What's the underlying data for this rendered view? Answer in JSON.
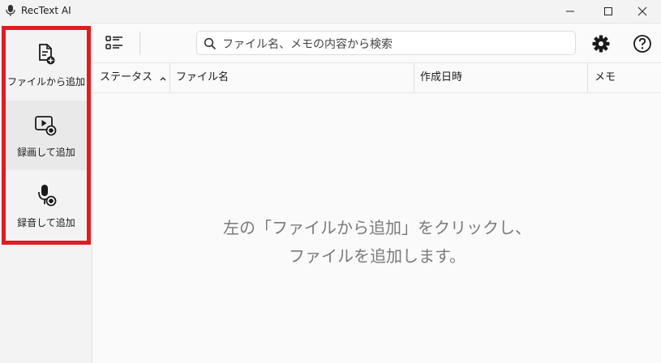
{
  "window": {
    "title": "RecText AI"
  },
  "sidebar": {
    "items": [
      {
        "label": "ファイルから追加",
        "icon": "file-add-icon"
      },
      {
        "label": "録画して追加",
        "icon": "video-record-icon"
      },
      {
        "label": "録音して追加",
        "icon": "mic-record-icon"
      }
    ],
    "selected_index": 1
  },
  "toolbar": {
    "search_placeholder": "ファイル名、メモの内容から検索"
  },
  "table": {
    "columns": [
      "ステータス",
      "ファイル名",
      "作成日時",
      "メモ"
    ],
    "sort_column": "ステータス",
    "sort_direction": "ascending"
  },
  "empty_state": {
    "line1": "左の「ファイルから追加」をクリックし、",
    "line2": "ファイルを追加します。"
  },
  "colors": {
    "highlight_border": "#e01b24",
    "text": "#1a1a1a",
    "muted": "#7a7a7a"
  }
}
